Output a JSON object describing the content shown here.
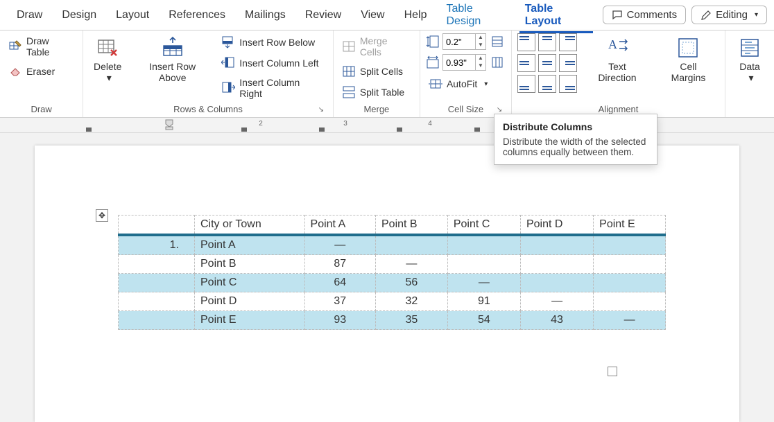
{
  "tabs": {
    "draw": "Draw",
    "design": "Design",
    "layout": "Layout",
    "references": "References",
    "mailings": "Mailings",
    "review": "Review",
    "view": "View",
    "help": "Help",
    "table_design": "Table Design",
    "table_layout": "Table Layout"
  },
  "topright": {
    "comments": "Comments",
    "editing": "Editing"
  },
  "ribbon": {
    "draw": {
      "draw_table": "Draw Table",
      "eraser": "Eraser",
      "label": "Draw"
    },
    "rows_cols": {
      "delete": "Delete",
      "insert_above": "Insert Row Above",
      "insert_below": "Insert Row Below",
      "insert_left": "Insert Column Left",
      "insert_right": "Insert Column Right",
      "label": "Rows & Columns"
    },
    "merge": {
      "merge_cells": "Merge Cells",
      "split_cells": "Split Cells",
      "split_table": "Split Table",
      "label": "Merge"
    },
    "cell_size": {
      "height": "0.2\"",
      "width": "0.93\"",
      "autofit": "AutoFit",
      "label": "Cell Size"
    },
    "alignment": {
      "text_direction": "Text Direction",
      "cell_margins": "Cell Margins",
      "label": "Alignment"
    },
    "data": {
      "data": "Data"
    }
  },
  "tooltip": {
    "title": "Distribute Columns",
    "body": "Distribute the width of the selected columns equally between them."
  },
  "ruler_numbers": [
    "2",
    "3",
    "4"
  ],
  "chart_data": {
    "type": "table",
    "headers": [
      "",
      "City or Town",
      "Point A",
      "Point B",
      "Point C",
      "Point D",
      "Point E"
    ],
    "numbered_row": "1.",
    "rows": [
      {
        "label": "Point A",
        "vals": [
          "—",
          "",
          "",
          "",
          ""
        ],
        "alt": true
      },
      {
        "label": "Point B",
        "vals": [
          "87",
          "—",
          "",
          "",
          ""
        ],
        "alt": false
      },
      {
        "label": "Point C",
        "vals": [
          "64",
          "56",
          "—",
          "",
          ""
        ],
        "alt": true
      },
      {
        "label": "Point D",
        "vals": [
          "37",
          "32",
          "91",
          "—",
          ""
        ],
        "alt": false
      },
      {
        "label": "Point E",
        "vals": [
          "93",
          "35",
          "54",
          "43",
          "—"
        ],
        "alt": true
      }
    ]
  }
}
